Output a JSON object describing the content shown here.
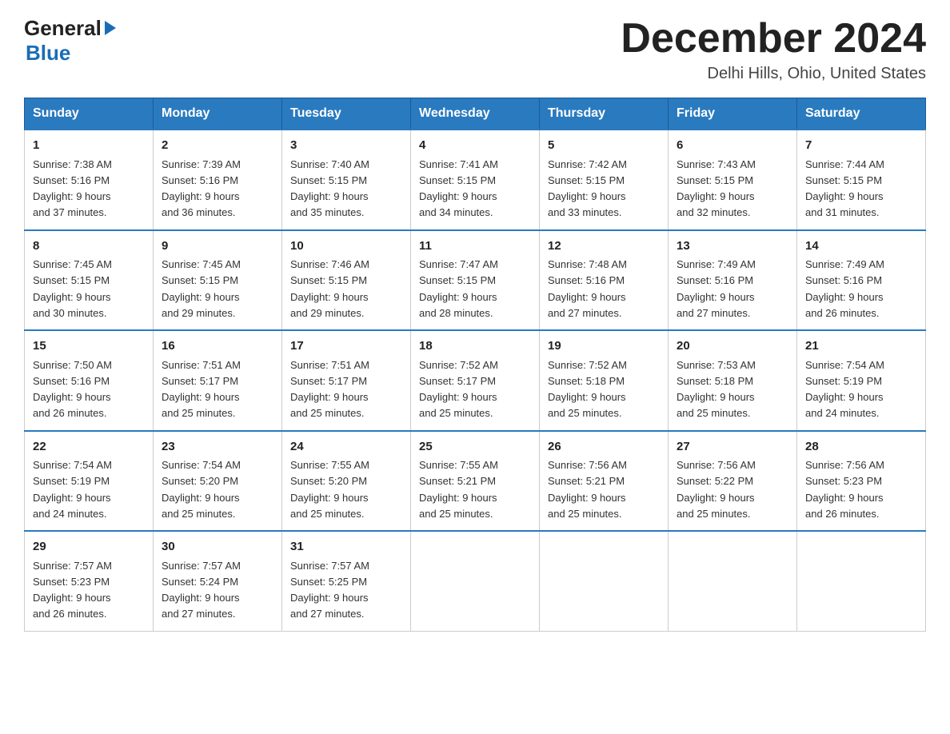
{
  "header": {
    "logo_general": "General",
    "logo_blue": "Blue",
    "month_title": "December 2024",
    "location": "Delhi Hills, Ohio, United States"
  },
  "days_of_week": [
    "Sunday",
    "Monday",
    "Tuesday",
    "Wednesday",
    "Thursday",
    "Friday",
    "Saturday"
  ],
  "weeks": [
    [
      {
        "day": "1",
        "sunrise": "7:38 AM",
        "sunset": "5:16 PM",
        "daylight": "9 hours and 37 minutes."
      },
      {
        "day": "2",
        "sunrise": "7:39 AM",
        "sunset": "5:16 PM",
        "daylight": "9 hours and 36 minutes."
      },
      {
        "day": "3",
        "sunrise": "7:40 AM",
        "sunset": "5:15 PM",
        "daylight": "9 hours and 35 minutes."
      },
      {
        "day": "4",
        "sunrise": "7:41 AM",
        "sunset": "5:15 PM",
        "daylight": "9 hours and 34 minutes."
      },
      {
        "day": "5",
        "sunrise": "7:42 AM",
        "sunset": "5:15 PM",
        "daylight": "9 hours and 33 minutes."
      },
      {
        "day": "6",
        "sunrise": "7:43 AM",
        "sunset": "5:15 PM",
        "daylight": "9 hours and 32 minutes."
      },
      {
        "day": "7",
        "sunrise": "7:44 AM",
        "sunset": "5:15 PM",
        "daylight": "9 hours and 31 minutes."
      }
    ],
    [
      {
        "day": "8",
        "sunrise": "7:45 AM",
        "sunset": "5:15 PM",
        "daylight": "9 hours and 30 minutes."
      },
      {
        "day": "9",
        "sunrise": "7:45 AM",
        "sunset": "5:15 PM",
        "daylight": "9 hours and 29 minutes."
      },
      {
        "day": "10",
        "sunrise": "7:46 AM",
        "sunset": "5:15 PM",
        "daylight": "9 hours and 29 minutes."
      },
      {
        "day": "11",
        "sunrise": "7:47 AM",
        "sunset": "5:15 PM",
        "daylight": "9 hours and 28 minutes."
      },
      {
        "day": "12",
        "sunrise": "7:48 AM",
        "sunset": "5:16 PM",
        "daylight": "9 hours and 27 minutes."
      },
      {
        "day": "13",
        "sunrise": "7:49 AM",
        "sunset": "5:16 PM",
        "daylight": "9 hours and 27 minutes."
      },
      {
        "day": "14",
        "sunrise": "7:49 AM",
        "sunset": "5:16 PM",
        "daylight": "9 hours and 26 minutes."
      }
    ],
    [
      {
        "day": "15",
        "sunrise": "7:50 AM",
        "sunset": "5:16 PM",
        "daylight": "9 hours and 26 minutes."
      },
      {
        "day": "16",
        "sunrise": "7:51 AM",
        "sunset": "5:17 PM",
        "daylight": "9 hours and 25 minutes."
      },
      {
        "day": "17",
        "sunrise": "7:51 AM",
        "sunset": "5:17 PM",
        "daylight": "9 hours and 25 minutes."
      },
      {
        "day": "18",
        "sunrise": "7:52 AM",
        "sunset": "5:17 PM",
        "daylight": "9 hours and 25 minutes."
      },
      {
        "day": "19",
        "sunrise": "7:52 AM",
        "sunset": "5:18 PM",
        "daylight": "9 hours and 25 minutes."
      },
      {
        "day": "20",
        "sunrise": "7:53 AM",
        "sunset": "5:18 PM",
        "daylight": "9 hours and 25 minutes."
      },
      {
        "day": "21",
        "sunrise": "7:54 AM",
        "sunset": "5:19 PM",
        "daylight": "9 hours and 24 minutes."
      }
    ],
    [
      {
        "day": "22",
        "sunrise": "7:54 AM",
        "sunset": "5:19 PM",
        "daylight": "9 hours and 24 minutes."
      },
      {
        "day": "23",
        "sunrise": "7:54 AM",
        "sunset": "5:20 PM",
        "daylight": "9 hours and 25 minutes."
      },
      {
        "day": "24",
        "sunrise": "7:55 AM",
        "sunset": "5:20 PM",
        "daylight": "9 hours and 25 minutes."
      },
      {
        "day": "25",
        "sunrise": "7:55 AM",
        "sunset": "5:21 PM",
        "daylight": "9 hours and 25 minutes."
      },
      {
        "day": "26",
        "sunrise": "7:56 AM",
        "sunset": "5:21 PM",
        "daylight": "9 hours and 25 minutes."
      },
      {
        "day": "27",
        "sunrise": "7:56 AM",
        "sunset": "5:22 PM",
        "daylight": "9 hours and 25 minutes."
      },
      {
        "day": "28",
        "sunrise": "7:56 AM",
        "sunset": "5:23 PM",
        "daylight": "9 hours and 26 minutes."
      }
    ],
    [
      {
        "day": "29",
        "sunrise": "7:57 AM",
        "sunset": "5:23 PM",
        "daylight": "9 hours and 26 minutes."
      },
      {
        "day": "30",
        "sunrise": "7:57 AM",
        "sunset": "5:24 PM",
        "daylight": "9 hours and 27 minutes."
      },
      {
        "day": "31",
        "sunrise": "7:57 AM",
        "sunset": "5:25 PM",
        "daylight": "9 hours and 27 minutes."
      },
      null,
      null,
      null,
      null
    ]
  ],
  "labels": {
    "sunrise": "Sunrise:",
    "sunset": "Sunset:",
    "daylight": "Daylight:"
  }
}
